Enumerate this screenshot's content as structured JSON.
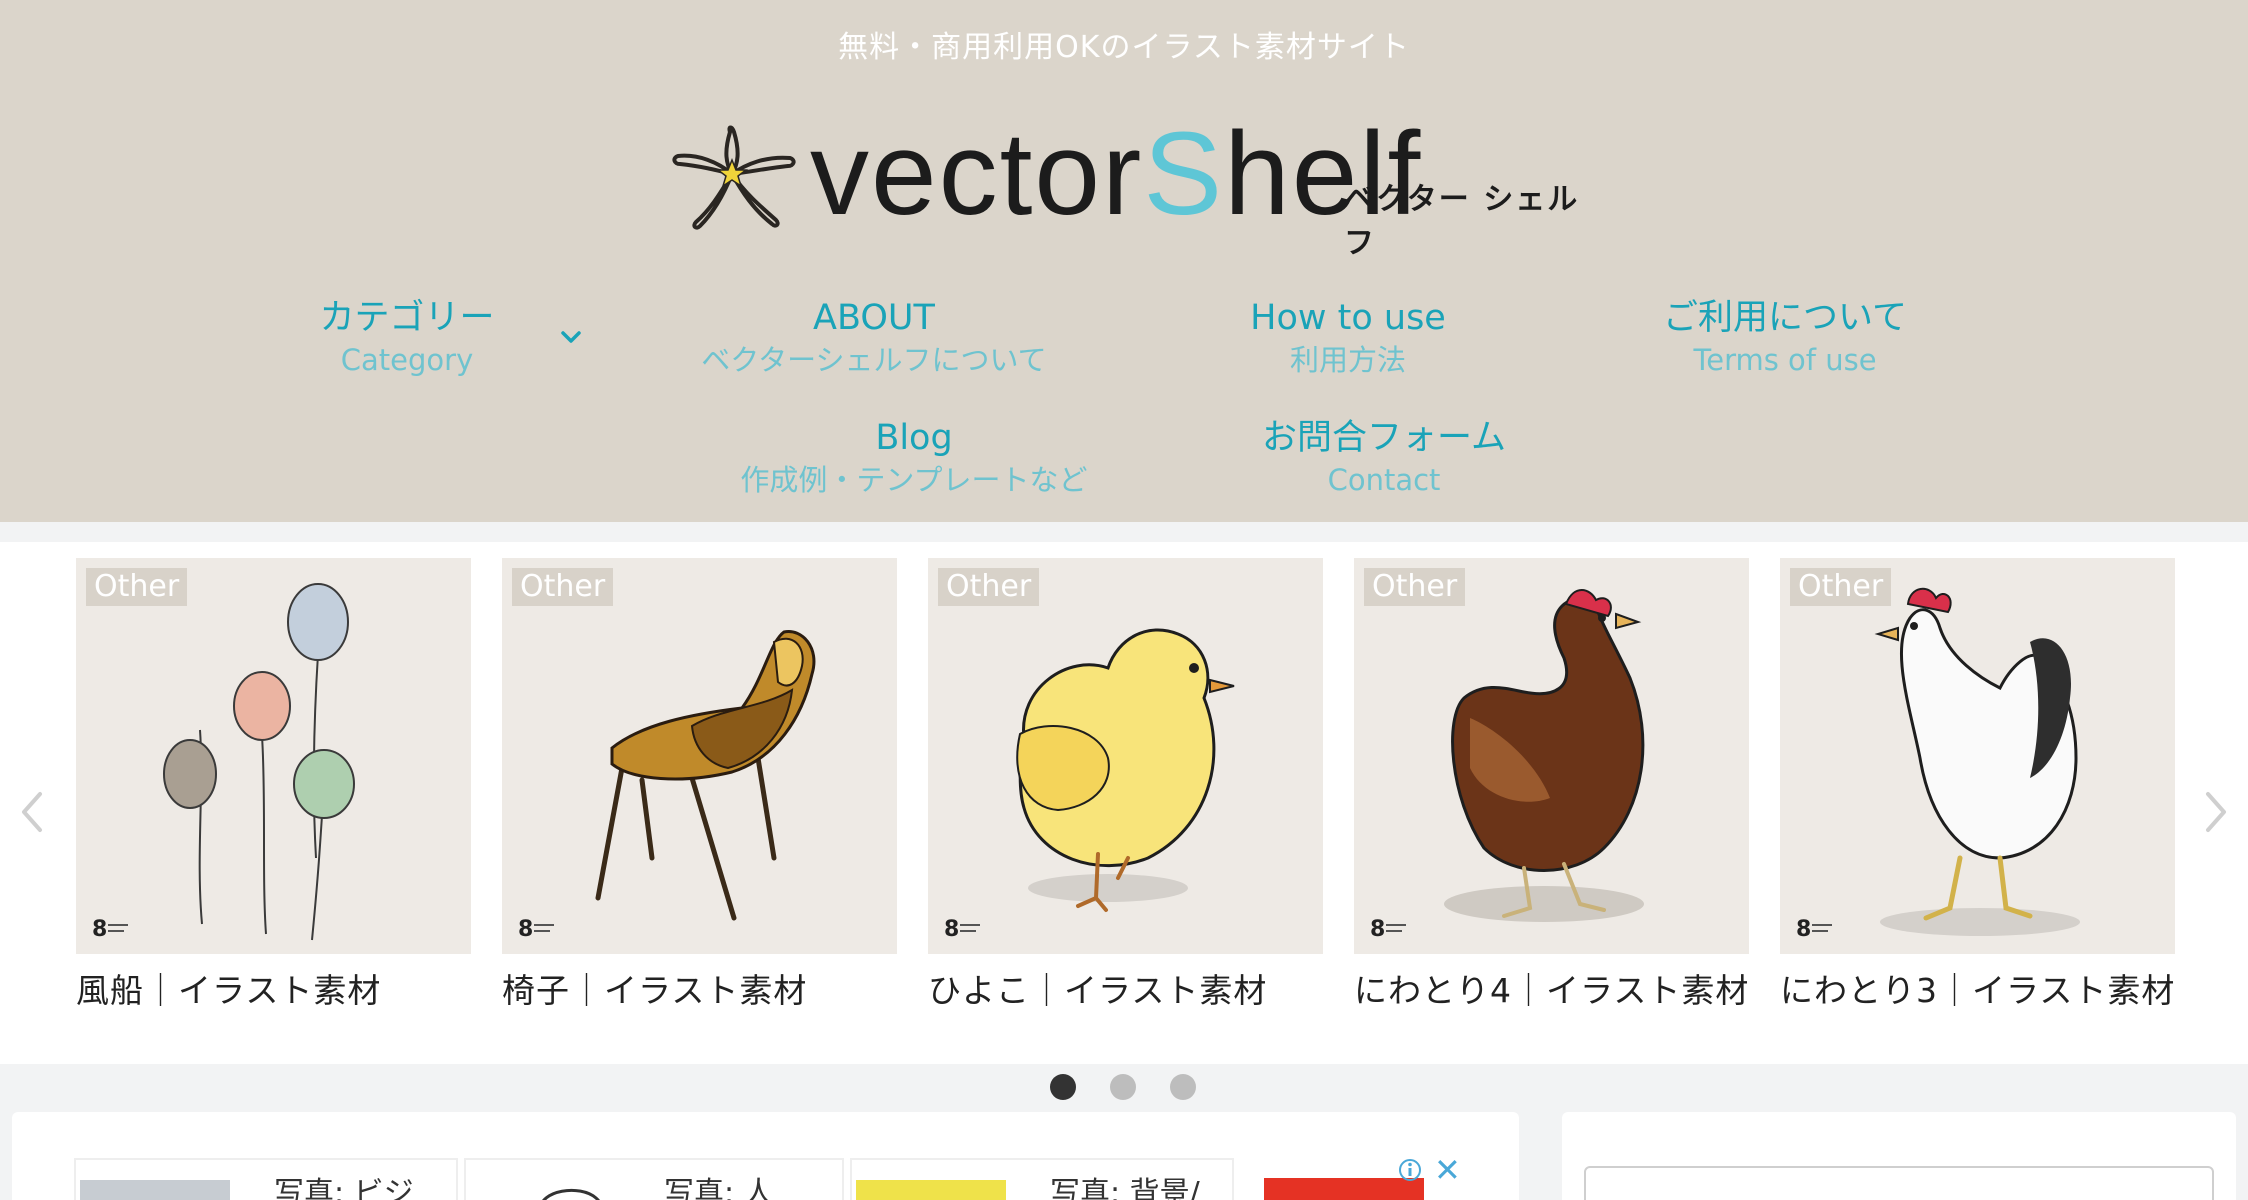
{
  "header": {
    "tagline": "無料・商用利用OKのイラスト素材サイト",
    "logo_text_before": "vector",
    "logo_text_s": "S",
    "logo_text_after": "helf",
    "logo_subtitle": "ベクター シェルフ"
  },
  "nav": [
    {
      "main": "カテゴリー",
      "sub": "Category"
    },
    {
      "main": "ABOUT",
      "sub": "ベクターシェルフについて"
    },
    {
      "main": "How to use",
      "sub": "利用方法"
    },
    {
      "main": "ご利用について",
      "sub": "Terms of use"
    },
    {
      "main": "Blog",
      "sub": "作成例・テンプレートなど"
    },
    {
      "main": "お問合フォーム",
      "sub": "Contact"
    }
  ],
  "carousel": {
    "items": [
      {
        "badge": "Other",
        "title": "風船｜イラスト素材",
        "icon": "balloons-illustration"
      },
      {
        "badge": "Other",
        "title": "椅子｜イラスト素材",
        "icon": "chair-illustration"
      },
      {
        "badge": "Other",
        "title": "ひよこ｜イラスト素材",
        "icon": "chick-illustration"
      },
      {
        "badge": "Other",
        "title": "にわとり4｜イラスト素材",
        "icon": "brown-hen-illustration"
      },
      {
        "badge": "Other",
        "title": "にわとり3｜イラスト素材",
        "icon": "white-rooster-illustration"
      }
    ],
    "page_count": 3,
    "active_page": 1
  },
  "ads": [
    {
      "text": "写真: ビジ"
    },
    {
      "text": "写真: 人"
    },
    {
      "text": "写真: 背景/"
    }
  ],
  "colors": {
    "header_bg": "#dbd5cb",
    "nav_main": "#1aa3b8",
    "nav_sub": "#6fc3cf",
    "logo_accent": "#5ec6d6",
    "card_bg": "#eeeae5"
  }
}
